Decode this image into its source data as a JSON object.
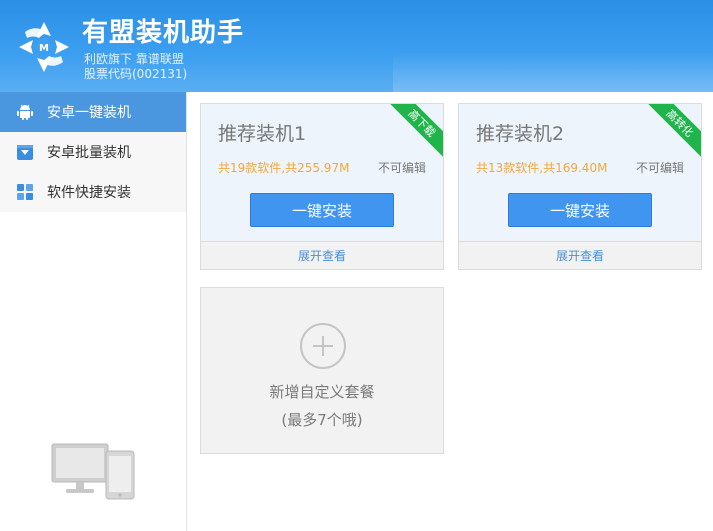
{
  "header": {
    "title": "有盟装机助手",
    "subtitle_line1": "利欧旗下  靠谱联盟",
    "subtitle_line2": "股票代码(002131)",
    "logo_icon": "youmeng-logo-icon"
  },
  "sidebar": {
    "items": [
      {
        "label": "安卓一键装机",
        "icon": "android-icon",
        "active": true
      },
      {
        "label": "安卓批量装机",
        "icon": "download-box-icon",
        "active": false
      },
      {
        "label": "软件快捷安装",
        "icon": "apps-grid-icon",
        "active": false
      }
    ],
    "illustration": "devices-icon"
  },
  "cards": [
    {
      "title": "推荐装机1",
      "info": "共19款软件,共255.97M",
      "edit": "不可编辑",
      "button": "一键安装",
      "footer": "展开查看",
      "ribbon": "高下载"
    },
    {
      "title": "推荐装机2",
      "info": "共13款软件,共169.40M",
      "edit": "不可编辑",
      "button": "一键安装",
      "footer": "展开查看",
      "ribbon": "高转化"
    }
  ],
  "add_card": {
    "line1": "新增自定义套餐",
    "line2": "(最多7个哦)",
    "icon": "plus-circle-icon"
  },
  "colors": {
    "header_blue": "#3d9ff0",
    "active_nav": "#4a97e0",
    "button_blue": "#3f95ef",
    "ribbon_green": "#1fb54a",
    "info_orange": "#f3a73a"
  }
}
